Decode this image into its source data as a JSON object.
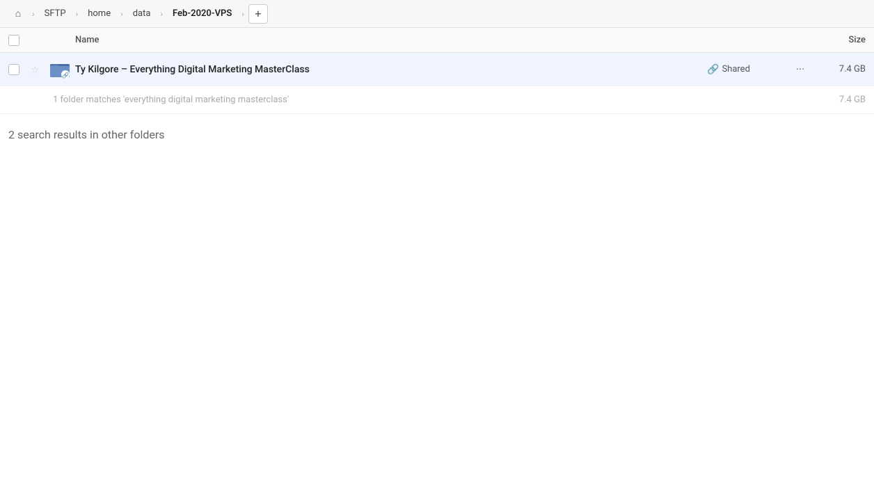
{
  "header": {
    "home_icon": "⌂",
    "breadcrumbs": [
      {
        "label": "SFTP",
        "active": false
      },
      {
        "label": "home",
        "active": false
      },
      {
        "label": "data",
        "active": false
      },
      {
        "label": "Feb-2020-VPS",
        "active": true
      }
    ],
    "add_icon": "+"
  },
  "table": {
    "col_name_label": "Name",
    "col_size_label": "Size"
  },
  "file_row": {
    "name": "Ty Kilgore – Everything Digital Marketing MasterClass",
    "shared_label": "Shared",
    "size": "7.4 GB",
    "sub_match_text": "1 folder matches 'everything digital marketing masterclass'",
    "sub_match_size": "7.4 GB"
  },
  "other_folders": {
    "title": "2 search results in other folders"
  }
}
